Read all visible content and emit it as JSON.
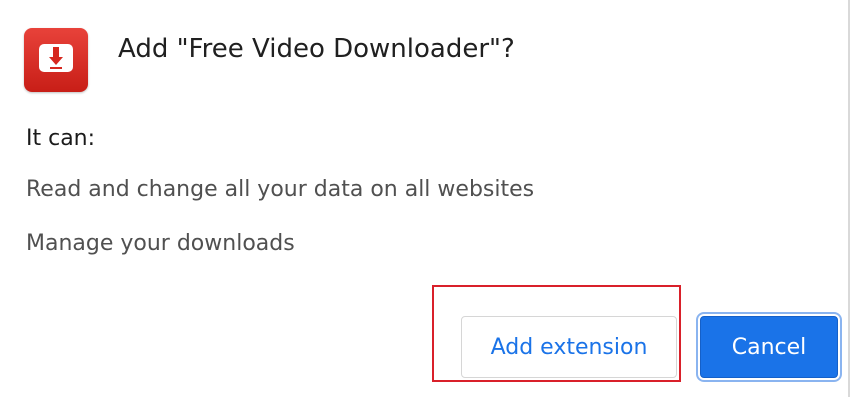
{
  "dialog": {
    "icon": "red-download-app-icon",
    "title": "Add \"Free Video Downloader\"?",
    "capabilities_heading": "It can:",
    "permissions": [
      "Read and change all your data on all websites",
      "Manage your downloads"
    ],
    "buttons": {
      "add_label": "Add extension",
      "cancel_label": "Cancel"
    }
  },
  "colors": {
    "accent_blue": "#1a73e8",
    "icon_red": "#d6281f",
    "highlight_red": "#d9202a"
  }
}
